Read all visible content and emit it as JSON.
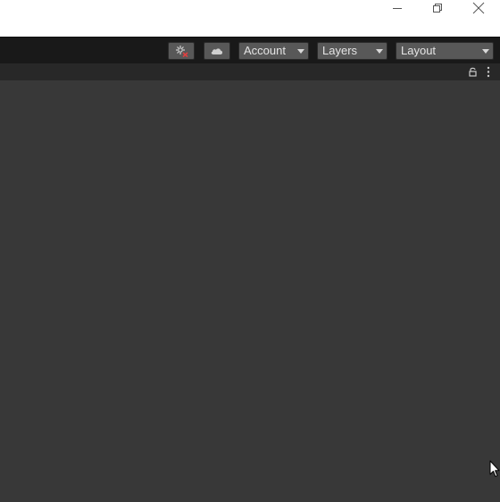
{
  "window": {
    "controls": [
      "minimize-icon",
      "restore-icon",
      "close-icon"
    ]
  },
  "toolbar": {
    "buttons": [
      "collab-icon",
      "cloud-icon"
    ],
    "account_label": "Account",
    "layers_label": "Layers",
    "layout_label": "Layout"
  },
  "panel": {
    "header_icons": [
      "lock-icon",
      "kebab-menu-icon"
    ]
  },
  "colors": {
    "titlebar": "#ffffff",
    "toolbar": "#191919",
    "panel_header": "#282828",
    "panel_body": "#383838",
    "button": "#585858",
    "text": "#e4e4e4",
    "collab_error": "#e04040"
  }
}
